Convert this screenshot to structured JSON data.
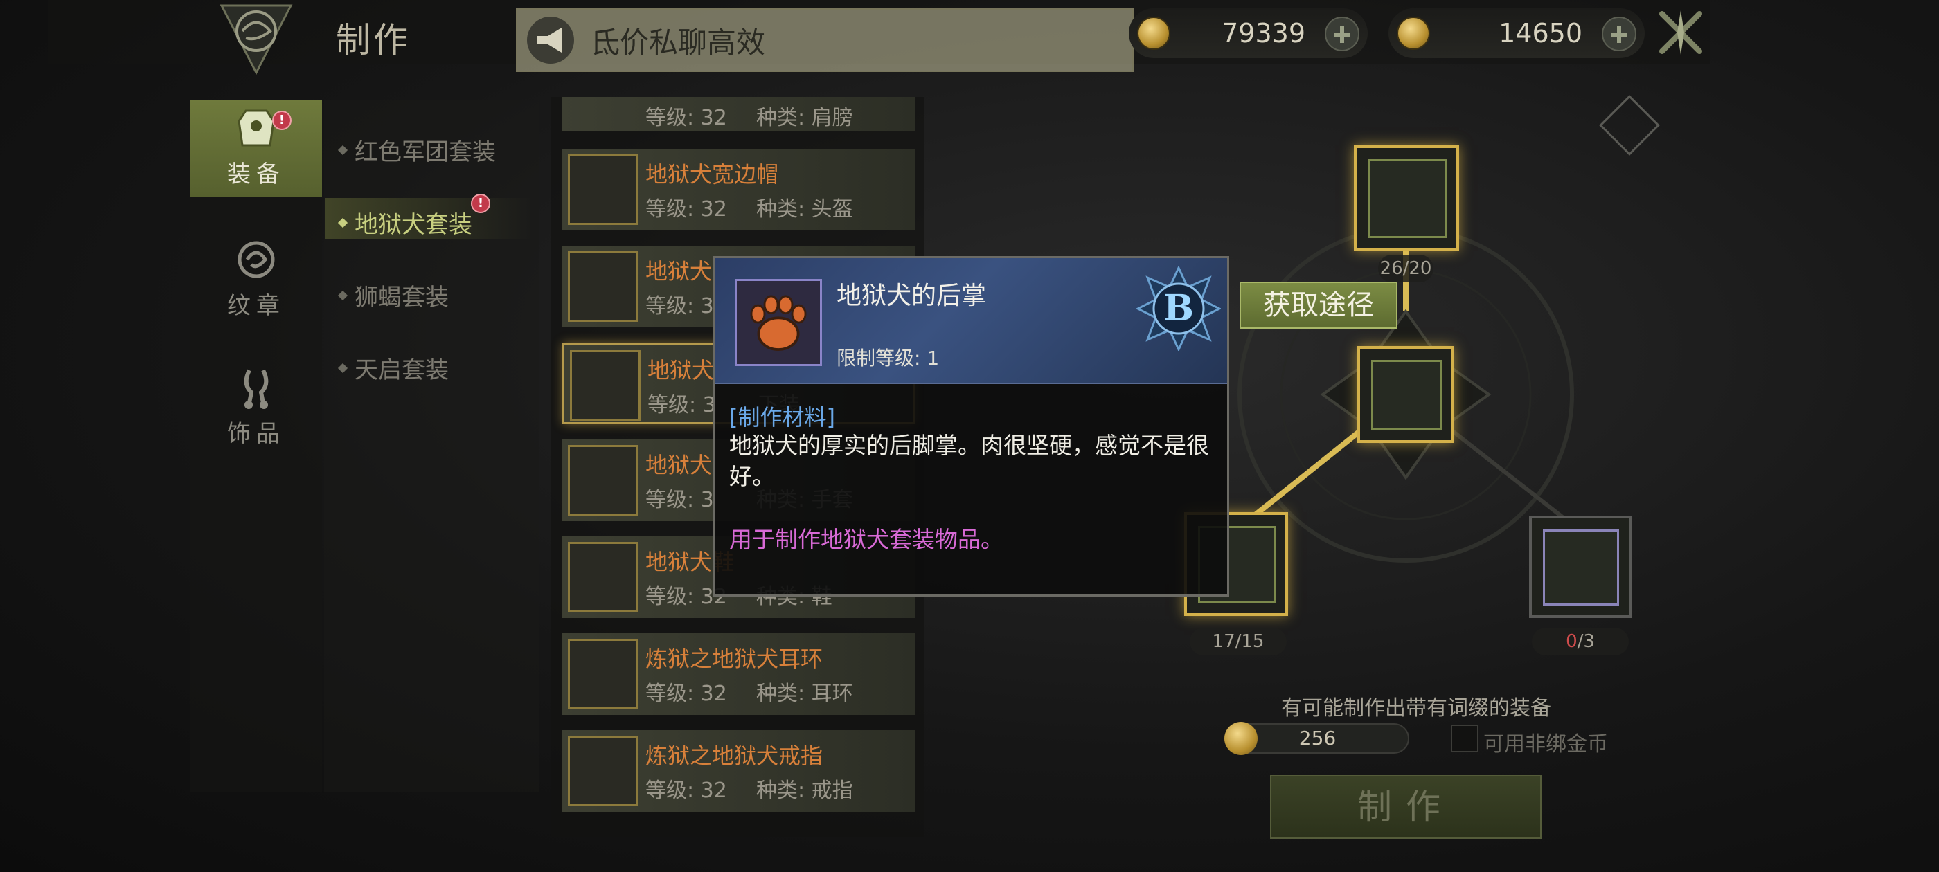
{
  "header": {
    "title": "制作",
    "broadcast_text": "氐价私聊高效",
    "currency_a": "79339",
    "currency_b": "14650"
  },
  "nav": {
    "items": [
      {
        "label": "装备",
        "icon": "armor-icon",
        "active": true,
        "alert": "!"
      },
      {
        "label": "纹章",
        "icon": "crest-icon",
        "active": false
      },
      {
        "label": "饰品",
        "icon": "accessory-icon",
        "active": false
      }
    ]
  },
  "sub_nav": {
    "items": [
      {
        "label": "红色军团套装",
        "active": false
      },
      {
        "label": "地狱犬套装",
        "active": true,
        "alert": "!"
      },
      {
        "label": "狮蝎套装",
        "active": false
      },
      {
        "label": "天启套装",
        "active": false
      }
    ]
  },
  "item_list": {
    "rows": [
      {
        "name": "",
        "level": "等级: 32",
        "type": "种类: 肩膀"
      },
      {
        "name": "地狱犬宽边帽",
        "level": "等级: 32",
        "type": "种类: 头盔"
      },
      {
        "name": "地狱犬",
        "level": "等级: 3",
        "type": ""
      },
      {
        "name": "地狱犬",
        "level": "等级: 3",
        "type": "下装"
      },
      {
        "name": "地狱犬",
        "level": "等级: 3",
        "type": "种类: 手套"
      },
      {
        "name": "地狱犬鞋",
        "level": "等级: 32",
        "type": "种类: 鞋"
      },
      {
        "name": "炼狱之地狱犬耳环",
        "level": "等级: 32",
        "type": "种类: 耳环"
      },
      {
        "name": "炼狱之地狱犬戒指",
        "level": "等级: 32",
        "type": "种类: 戒指"
      }
    ]
  },
  "craft": {
    "top_count": "26/20",
    "left_count": "17/15",
    "right_count_have": "0",
    "right_count_need": "/3",
    "acquire_button": "获取途径",
    "affix_note": "有可能制作出带有词缀的装备",
    "gold_cost": "256",
    "non_bound_label": "可用非绑金币",
    "make_button": "制作"
  },
  "tooltip": {
    "name": "地狱犬的后掌",
    "requirement": "限制等级: 1",
    "grade": "B",
    "category": "[制作材料]",
    "description": "地狱犬的厚实的后脚掌。肉很坚硬，感觉不是很好。",
    "usage": "用于制作地狱犬套装物品。"
  },
  "colors": {
    "accent_green": "#6f7a3c",
    "gold_border": "#d4b14a",
    "item_name_orange": "#d8803a",
    "usage_pink": "#d86ad6",
    "category_blue": "#6aa8e8"
  }
}
